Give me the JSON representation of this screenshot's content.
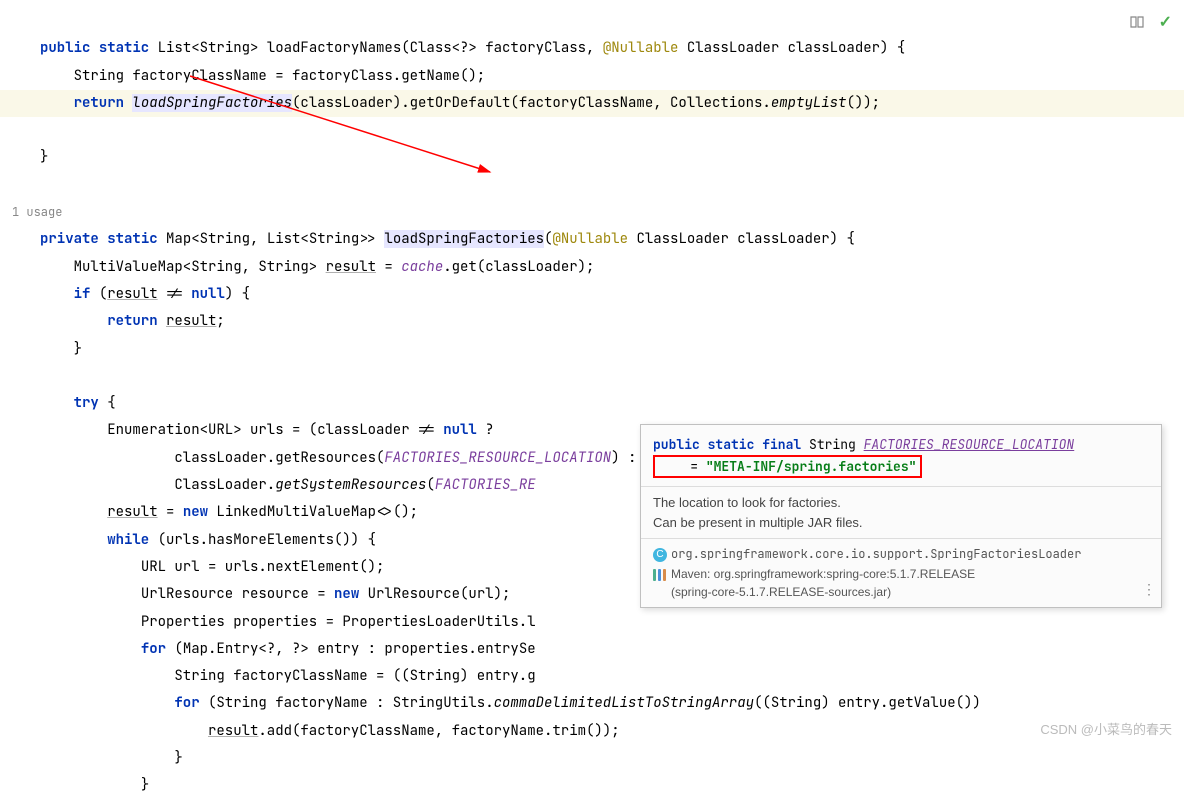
{
  "code": {
    "line1": {
      "public": "public",
      "static": "static",
      "ret": "List<String> loadFactoryNames(Class<?> factoryClass, ",
      "anno": "@Nullable",
      "rest": " ClassLoader classLoader) {"
    },
    "line2": {
      "txt1": "String factoryClassName = factoryClass.getName();"
    },
    "line3": {
      "kw": "return",
      "hl": "loadSpringFactories",
      "rest": "(classLoader).getOrDefault(factoryClassName, Collections.",
      "empty": "emptyList",
      "end": "());"
    },
    "line4": {
      "brace": "}"
    },
    "usage": "1 usage",
    "line5": {
      "private": "private",
      "static": "static",
      "ret": "Map<String, List<String>> ",
      "hl": "loadSpringFactories",
      "lparen": "(",
      "anno": "@Nullable",
      "rest": " ClassLoader classLoader) {"
    },
    "line6": {
      "txt1": "MultiValueMap<String, String> ",
      "var": "result",
      "eq": " = ",
      "field": "cache",
      "call": ".get(classLoader);"
    },
    "line7": {
      "if": "if",
      "open": " (",
      "var": "result",
      "cond": " != ",
      "null": "null",
      "close": ") {"
    },
    "line8": {
      "ret": "return",
      "sp": " ",
      "var": "result",
      "semi": ";"
    },
    "line9": {
      "brace": "}"
    },
    "line10": {
      "try": "try",
      "brace": " {"
    },
    "line11": {
      "txt1": "Enumeration<URL> urls = (classLoader != ",
      "null": "null",
      "q": " ?"
    },
    "line12": {
      "txt": "classLoader.getResources(",
      "loc": "FACTORIES_RESOURCE_LOCATION",
      "end": ") :"
    },
    "line13": {
      "cls": "ClassLoader.",
      "m": "getSystemResources",
      "lp": "(",
      "loc": "FACTORIES_RE"
    },
    "line14": {
      "var": "result",
      "eq": " = ",
      "new": "new",
      "rest": " LinkedMultiValueMap<>();"
    },
    "line15": {
      "while": "while",
      "txt": " (urls.hasMoreElements()) {"
    },
    "line16": {
      "txt": "URL url = urls.nextElement();"
    },
    "line17": {
      "txt1": "UrlResource resource = ",
      "new": "new",
      "rest": " UrlResource(url);"
    },
    "line18": {
      "txt1": "Properties properties = PropertiesLoaderUtils.l"
    },
    "line19": {
      "for": "for",
      "txt": " (Map.Entry<?, ?> entry : properties.entrySe"
    },
    "line20": {
      "txt": "String factoryClassName = ((String) entry.g"
    },
    "line21": {
      "for": "for",
      "txt1": " (String factoryName : StringUtils.",
      "ital": "commaDelimitedListToStringArray",
      "rest": "((String) entry.getValue())"
    },
    "line22": {
      "var": "result",
      "call": ".add(factoryClassName, factoryName.trim());"
    },
    "line23": {
      "brace": "}"
    },
    "line24": {
      "brace": "}"
    }
  },
  "tooltip": {
    "sig_pre": "public static final ",
    "sig_type": "String ",
    "sig_name": "FACTORIES_RESOURCE_LOCATION",
    "sig_eq": "    = ",
    "sig_val": "\"META-INF/spring.factories\"",
    "doc1": "The location to look for factories.",
    "doc2": "Can be present in multiple JAR files.",
    "badge": "C",
    "class_fqn": "org.springframework.core.io.support.SpringFactoriesLoader",
    "lib": "Maven: org.springframework:spring-core:5.1.7.RELEASE",
    "lib2": "(spring-core-5.1.7.RELEASE-sources.jar)"
  },
  "watermark": "CSDN @小菜鸟的春天"
}
